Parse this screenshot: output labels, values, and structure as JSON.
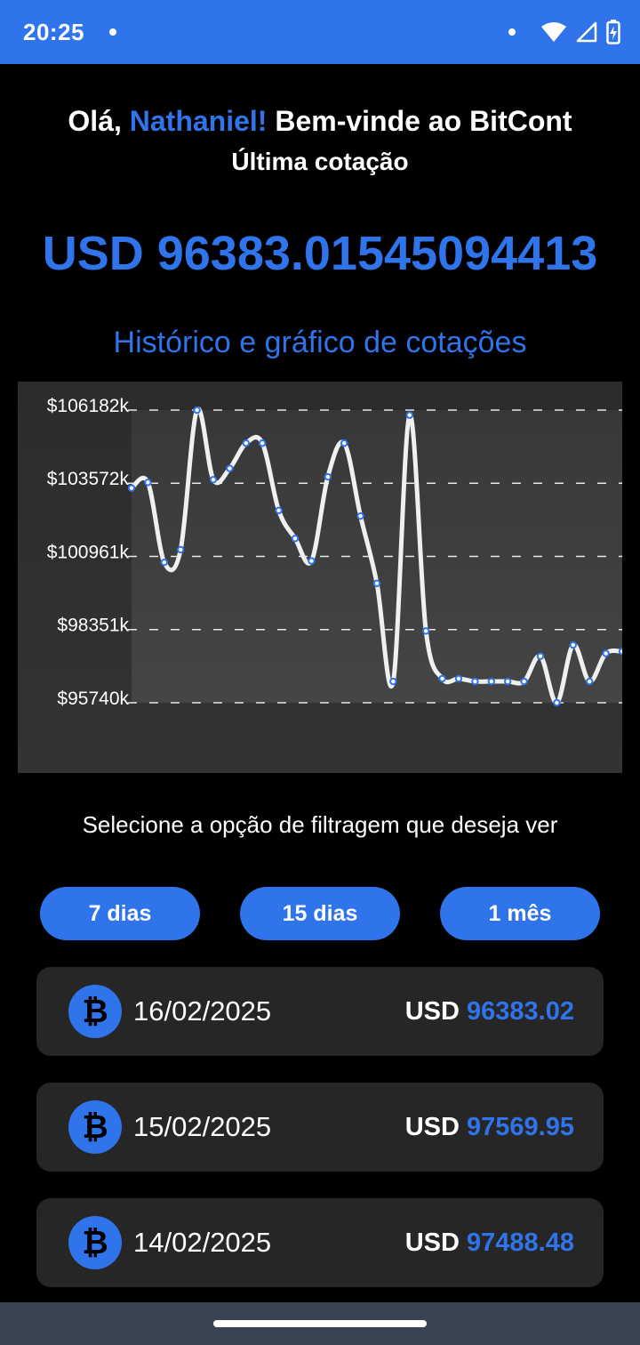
{
  "status_bar": {
    "time": "20:25",
    "icons": [
      "notification-dot-icon",
      "wifi-icon",
      "signal-icon",
      "battery-charging-icon"
    ]
  },
  "header": {
    "greeting_prefix": "Olá, ",
    "user_name": "Nathaniel!",
    "greeting_suffix": " Bem-vinde ao BitCont",
    "subtitle": "Última cotação",
    "latest_price": "USD 96383.01545094413"
  },
  "history": {
    "title": "Histórico e gráfico de cotações"
  },
  "chart_data": {
    "type": "line",
    "title": "",
    "xlabel": "",
    "ylabel": "",
    "y_tick_labels": [
      "$106182k",
      "$103572k",
      "$100961k",
      "$98351k",
      "$95740k"
    ],
    "y_ticks": [
      106182,
      103572,
      100961,
      98351,
      95740
    ],
    "ylim": [
      95740,
      106182
    ],
    "grid": "horizontal dashed",
    "line_color": "#f0f0f0",
    "point_color": "#2f74ea",
    "values": [
      103400,
      103600,
      100750,
      101200,
      106180,
      103700,
      104100,
      105000,
      105000,
      102600,
      101600,
      100800,
      103800,
      105000,
      102400,
      100000,
      96500,
      106000,
      98300,
      96600,
      96600,
      96500,
      96500,
      96500,
      96500,
      97400,
      95740,
      97800,
      96500,
      97500,
      97570
    ]
  },
  "filter": {
    "label": "Selecione a opção de filtragem que deseja ver",
    "options": [
      "7 dias",
      "15 dias",
      "1 mês"
    ]
  },
  "quotes": [
    {
      "date": "16/02/2025",
      "currency": "USD",
      "value": "96383.02"
    },
    {
      "date": "15/02/2025",
      "currency": "USD",
      "value": "97569.95"
    },
    {
      "date": "14/02/2025",
      "currency": "USD",
      "value": "97488.48"
    }
  ],
  "coin_icon": "bitcoin-icon",
  "coin_symbol": "₿",
  "colors": {
    "accent": "#2f74ea",
    "background": "#000000",
    "card": "#262626",
    "nav_bar": "#3a4350"
  }
}
